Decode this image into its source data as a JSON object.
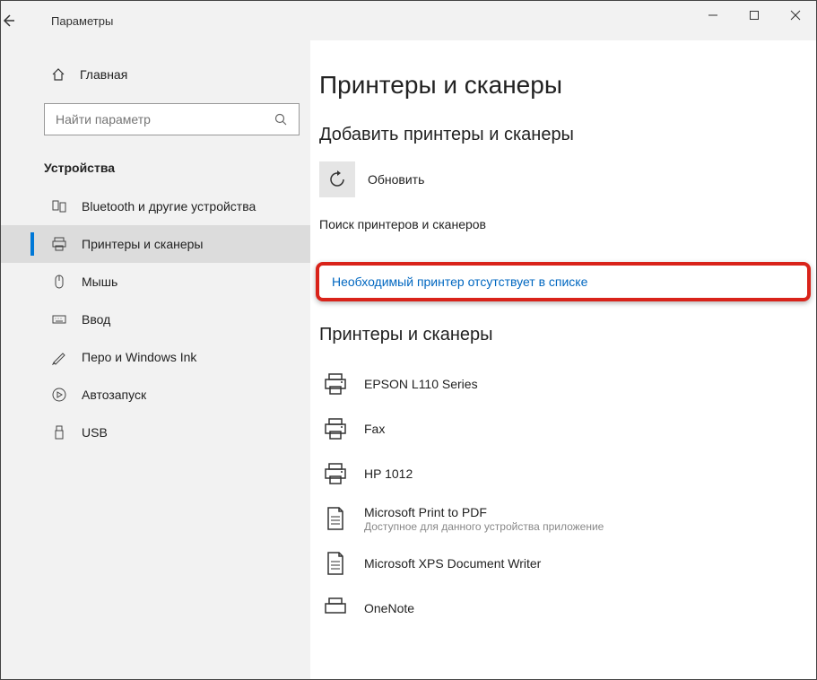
{
  "window": {
    "title": "Параметры"
  },
  "sidebar": {
    "home": "Главная",
    "search_placeholder": "Найти параметр",
    "group": "Устройства",
    "items": [
      {
        "label": "Bluetooth и другие устройства"
      },
      {
        "label": "Принтеры и сканеры"
      },
      {
        "label": "Мышь"
      },
      {
        "label": "Ввод"
      },
      {
        "label": "Перо и Windows Ink"
      },
      {
        "label": "Автозапуск"
      },
      {
        "label": "USB"
      }
    ]
  },
  "main": {
    "page_title": "Принтеры и сканеры",
    "add_section": "Добавить принтеры и сканеры",
    "refresh": "Обновить",
    "search_status": "Поиск принтеров и сканеров",
    "missing_link": "Необходимый принтер отсутствует в списке",
    "list_section": "Принтеры и сканеры",
    "printers": [
      {
        "name": "EPSON L110 Series",
        "sub": ""
      },
      {
        "name": "Fax",
        "sub": ""
      },
      {
        "name": "HP 1012",
        "sub": ""
      },
      {
        "name": "Microsoft Print to PDF",
        "sub": "Доступное для данного устройства приложение"
      },
      {
        "name": "Microsoft XPS Document Writer",
        "sub": ""
      },
      {
        "name": "OneNote",
        "sub": ""
      }
    ]
  }
}
